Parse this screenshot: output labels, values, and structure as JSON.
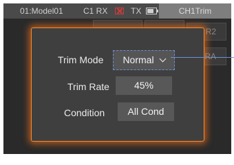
{
  "status_bar": {
    "model": "01:Model01",
    "c1rx": "C1 RX",
    "tx": "TX",
    "tab_label": "CH1Trim"
  },
  "background": {
    "button_r2": "R2",
    "button_ra": "RA"
  },
  "dialog": {
    "trim_mode_label": "Trim Mode",
    "trim_mode_value": "Normal",
    "trim_rate_label": "Trim Rate",
    "trim_rate_value": "45%",
    "condition_label": "Condition",
    "condition_value": "All Cond"
  },
  "colors": {
    "accent": "#ff8a2a",
    "selection": "#6f8fd6",
    "rx_indicator": "#d33a3a"
  }
}
